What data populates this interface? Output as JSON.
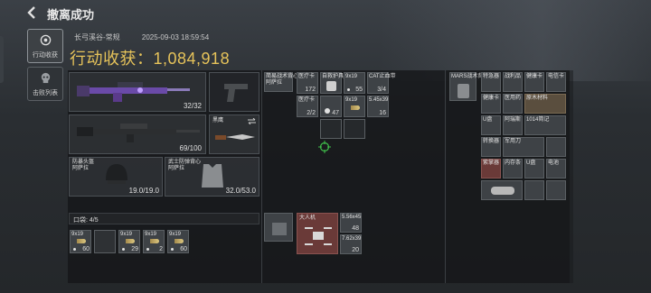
{
  "header": {
    "back_label": "撤离成功"
  },
  "sidebar": {
    "items": [
      {
        "label": "行动收获",
        "active": true,
        "icon": "target-icon"
      },
      {
        "label": "击败列表",
        "active": false,
        "icon": "skull-icon"
      }
    ]
  },
  "info": {
    "map": "长弓溪谷-常规",
    "datetime": "2025-09-03 18:59:54"
  },
  "earnings": {
    "label": "行动收获：",
    "value": "1,084,918"
  },
  "weapons": {
    "primary_count": "32/32",
    "secondary_count": "69/100",
    "knife_name": "黑鹰"
  },
  "armor": {
    "helmet": {
      "name": "防暴头盔",
      "sub": "阿萨拉",
      "durability": "19.0/19.0"
    },
    "vest": {
      "name": "武士防弹背心",
      "sub": "阿萨拉",
      "durability": "32.0/53.0"
    }
  },
  "pocket": {
    "label": "口袋: 4/5",
    "items": [
      {
        "name": "9x19",
        "count": "60"
      },
      {
        "name": "9x19",
        "count": "29"
      },
      {
        "name": "9x19",
        "count": "2"
      },
      {
        "name": "9x19",
        "count": "60"
      }
    ]
  },
  "chest_rig": {
    "items": [
      {
        "name": "简易战术背心",
        "sub": "阿萨拉"
      },
      {
        "name": "医疗卡",
        "count": "172"
      },
      {
        "name": "自救护具",
        "count": ""
      },
      {
        "name": "9x19",
        "count": "55"
      },
      {
        "name": "CAT止血带",
        "count": "3/4"
      },
      {
        "name": "医疗卡",
        "count": "2/2"
      },
      {
        "name": "",
        "count": "47"
      },
      {
        "name": "9x19",
        "count": ""
      },
      {
        "name": "5.45x39",
        "count": "16"
      }
    ]
  },
  "backpack": {
    "items": [
      {
        "name": "大人机",
        "count": ""
      },
      {
        "name": "5.56x45",
        "count": "48"
      },
      {
        "name": "7.62x39",
        "count": "20"
      }
    ]
  },
  "loot": {
    "header": "MARS战术背包",
    "items": [
      {
        "name": "特急器"
      },
      {
        "name": "战利品"
      },
      {
        "name": "健康卡"
      },
      {
        "name": "电信卡"
      },
      {
        "name": "健康卡"
      },
      {
        "name": "医用药"
      },
      {
        "name": "原木材料"
      },
      {
        "name": "U盘"
      },
      {
        "name": "阿瑞斯"
      },
      {
        "name": "1014简记"
      },
      {
        "name": "转换器"
      },
      {
        "name": "军用刀"
      },
      {
        "name": "紫掌器"
      },
      {
        "name": "内存条"
      },
      {
        "name": "U盘"
      },
      {
        "name": "电池"
      }
    ]
  }
}
